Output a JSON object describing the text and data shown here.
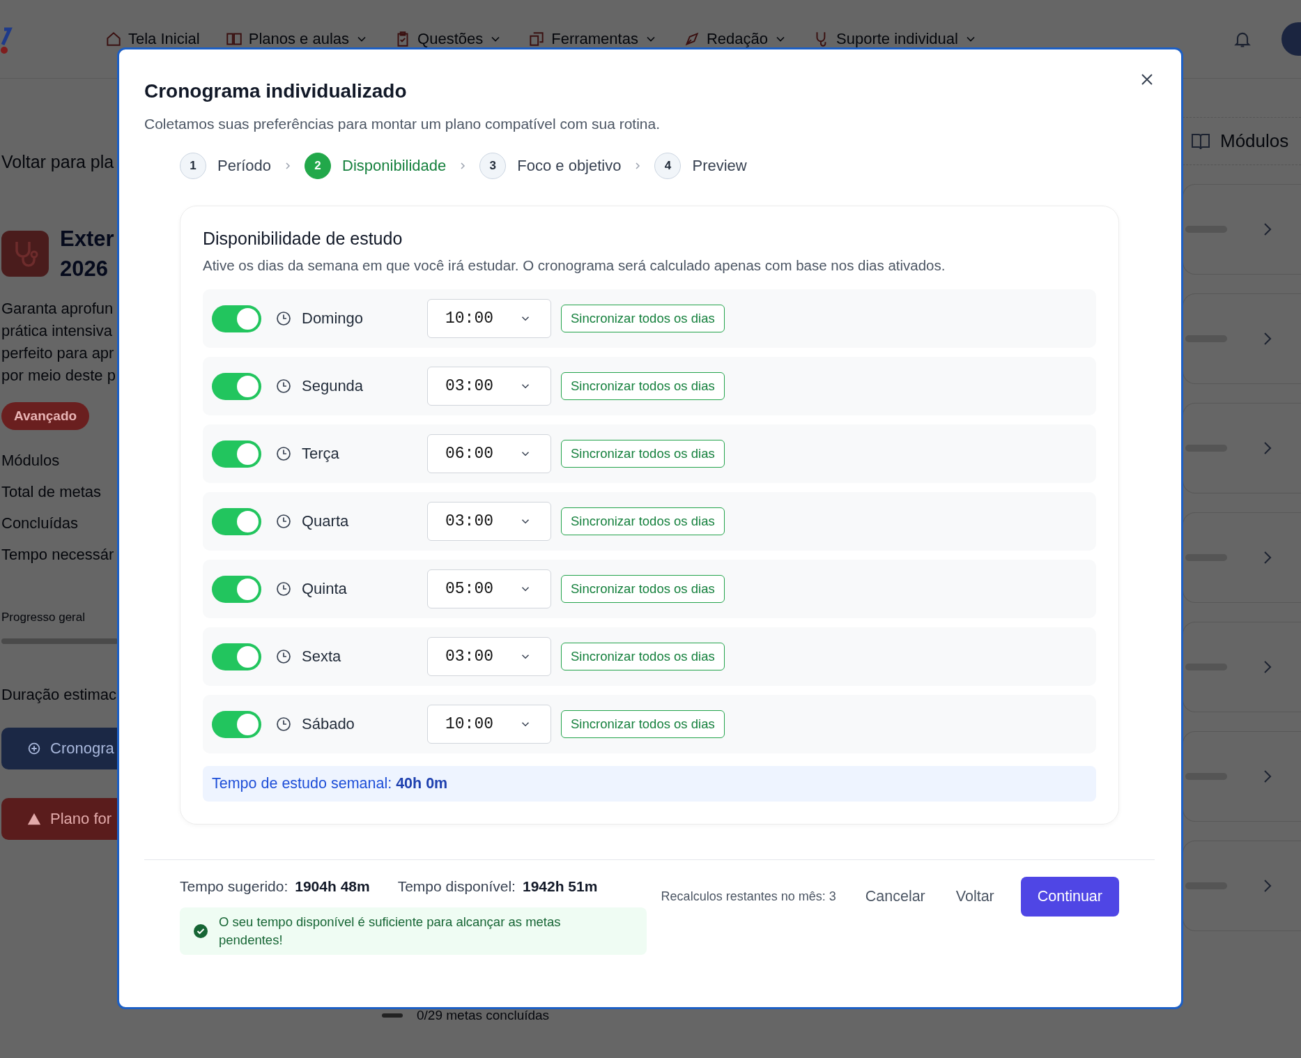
{
  "nav": {
    "items": [
      {
        "label": "Tela Inicial",
        "dropdown": false
      },
      {
        "label": "Planos e aulas",
        "dropdown": true
      },
      {
        "label": "Questões",
        "dropdown": true
      },
      {
        "label": "Ferramentas",
        "dropdown": true
      },
      {
        "label": "Redação",
        "dropdown": true
      },
      {
        "label": "Suporte individual",
        "dropdown": true
      }
    ]
  },
  "background": {
    "back_link": "Voltar para pla",
    "course_title": [
      "Exter",
      "2026"
    ],
    "description": [
      "Garanta aprofun",
      "prática intensiva",
      "perfeito para apr",
      "por meio deste p"
    ],
    "level_badge": "Avançado",
    "stats": [
      "Módulos",
      "Total de metas",
      "Concluídas",
      "Tempo necessár"
    ],
    "progress_label": "Progresso geral",
    "duration_label": "Duração estimac",
    "schedule_button": "Cronogra",
    "plan_button": "Plano for",
    "modules_heading": "Módulos",
    "goals_text": "0/29 metas concluídas"
  },
  "modal": {
    "title": "Cronograma individualizado",
    "subtitle": "Coletamos suas preferências para montar um plano compatível com sua rotina.",
    "steps": [
      {
        "number": "1",
        "label": "Período",
        "selected": false
      },
      {
        "number": "2",
        "label": "Disponibilidade",
        "selected": true
      },
      {
        "number": "3",
        "label": "Foco e objetivo",
        "selected": false
      },
      {
        "number": "4",
        "label": "Preview",
        "selected": false
      }
    ],
    "section_title": "Disponibilidade de estudo",
    "section_description": "Ative os dias da semana em que você irá estudar. O cronograma será calculado apenas com base nos dias ativados.",
    "days": [
      {
        "day": "Domingo",
        "on": true,
        "time": "10:00",
        "sync_label": "Sincronizar todos os dias"
      },
      {
        "day": "Segunda",
        "on": true,
        "time": "03:00",
        "sync_label": "Sincronizar todos os dias"
      },
      {
        "day": "Terça",
        "on": true,
        "time": "06:00",
        "sync_label": "Sincronizar todos os dias"
      },
      {
        "day": "Quarta",
        "on": true,
        "time": "03:00",
        "sync_label": "Sincronizar todos os dias"
      },
      {
        "day": "Quinta",
        "on": true,
        "time": "05:00",
        "sync_label": "Sincronizar todos os dias"
      },
      {
        "day": "Sexta",
        "on": true,
        "time": "03:00",
        "sync_label": "Sincronizar todos os dias"
      },
      {
        "day": "Sábado",
        "on": true,
        "time": "10:00",
        "sync_label": "Sincronizar todos os dias"
      }
    ],
    "weekly_total": "Tempo de estudo semanal: **40h 0m**",
    "suggested_label": "Tempo sugerido:",
    "suggested_value": "1904h 48m",
    "available_label": "Tempo disponível:",
    "available_value": "1942h 51m",
    "notice": "O seu tempo disponível é suficiente para alcançar as metas pendentes!",
    "recalc_text": "Recalculos restantes no mês: 3",
    "buttons": [
      {
        "label": "Cancelar",
        "kind": "text"
      },
      {
        "label": "Voltar",
        "kind": "text"
      },
      {
        "label": "Continuar",
        "kind": "primary"
      }
    ]
  }
}
